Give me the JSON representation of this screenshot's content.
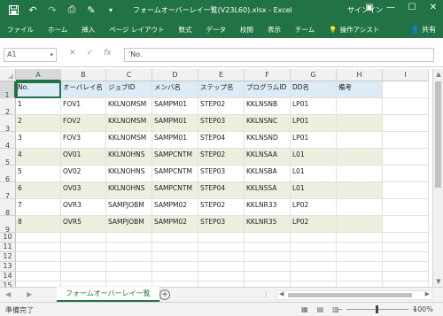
{
  "titlebar": {
    "document_title": "フォームオーバーレイ一覧(V23L60).xlsx  -  Excel",
    "signin": "サインイン",
    "qat_icons": [
      "save-icon",
      "undo-icon",
      "redo-icon",
      "print-preview-icon",
      "format-painter-icon",
      "customize-dropdown-icon"
    ],
    "window_icons": [
      "ribbon-display-icon",
      "minimize-icon",
      "maximize-icon",
      "close-icon"
    ]
  },
  "ribbon": {
    "tabs": [
      "ファイル",
      "ホーム",
      "挿入",
      "ページ レイアウト",
      "数式",
      "データ",
      "校閲",
      "表示",
      "チーム"
    ],
    "tell_me": "操作アシスト",
    "share": "共有"
  },
  "formula_bar": {
    "name_box": "A1",
    "formula": "'No."
  },
  "columns": [
    "A",
    "B",
    "C",
    "D",
    "E",
    "F",
    "G",
    "H",
    "I"
  ],
  "header_row": [
    "No.",
    "オーバレイ名",
    "ジョブID",
    "メンバ名",
    "ステップ名",
    "プログラムID",
    "DD名",
    "備考"
  ],
  "data_rows": [
    [
      "1",
      "FOV1",
      "KKLNOMSM",
      "SAMPM01",
      "STEP02",
      "KKLNSNB",
      "LP01",
      ""
    ],
    [
      "2",
      "FOV2",
      "KKLNOMSM",
      "SAMPM01",
      "STEP03",
      "KKLNSNC",
      "LP01",
      ""
    ],
    [
      "3",
      "FOV3",
      "KKLNOMSM",
      "SAMPM01",
      "STEP04",
      "KKLNSND",
      "LP01",
      ""
    ],
    [
      "4",
      "OV01",
      "KKLNOHNS",
      "SAMPCNTM",
      "STEP02",
      "KKLNSAA",
      "L01",
      ""
    ],
    [
      "5",
      "OV02",
      "KKLNOHNS",
      "SAMPCNTM",
      "STEP03",
      "KKLNSBA",
      "L01",
      ""
    ],
    [
      "6",
      "OV03",
      "KKLNOHNS",
      "SAMPCNTM",
      "STEP04",
      "KKLNSSA",
      "L01",
      ""
    ],
    [
      "7",
      "OVR3",
      "SAMPJOBM",
      "SAMPM02",
      "STEP02",
      "KKLNR33",
      "LP02",
      ""
    ],
    [
      "8",
      "OVR5",
      "SAMPJOBM",
      "SAMPM02",
      "STEP03",
      "KKLNR35",
      "LP02",
      ""
    ]
  ],
  "row_numbers": [
    "1",
    "2",
    "3",
    "4",
    "5",
    "6",
    "7",
    "8",
    "9",
    "10",
    "11",
    "12",
    "13",
    "14",
    "15"
  ],
  "sheet_tab": "フォームオーバーレイ一覧",
  "status": {
    "text": "準備完了",
    "zoom": "100%"
  },
  "colors": {
    "excel_green": "#217346",
    "header_fill": "#dcebf5",
    "band_fill": "#ebf1de"
  }
}
